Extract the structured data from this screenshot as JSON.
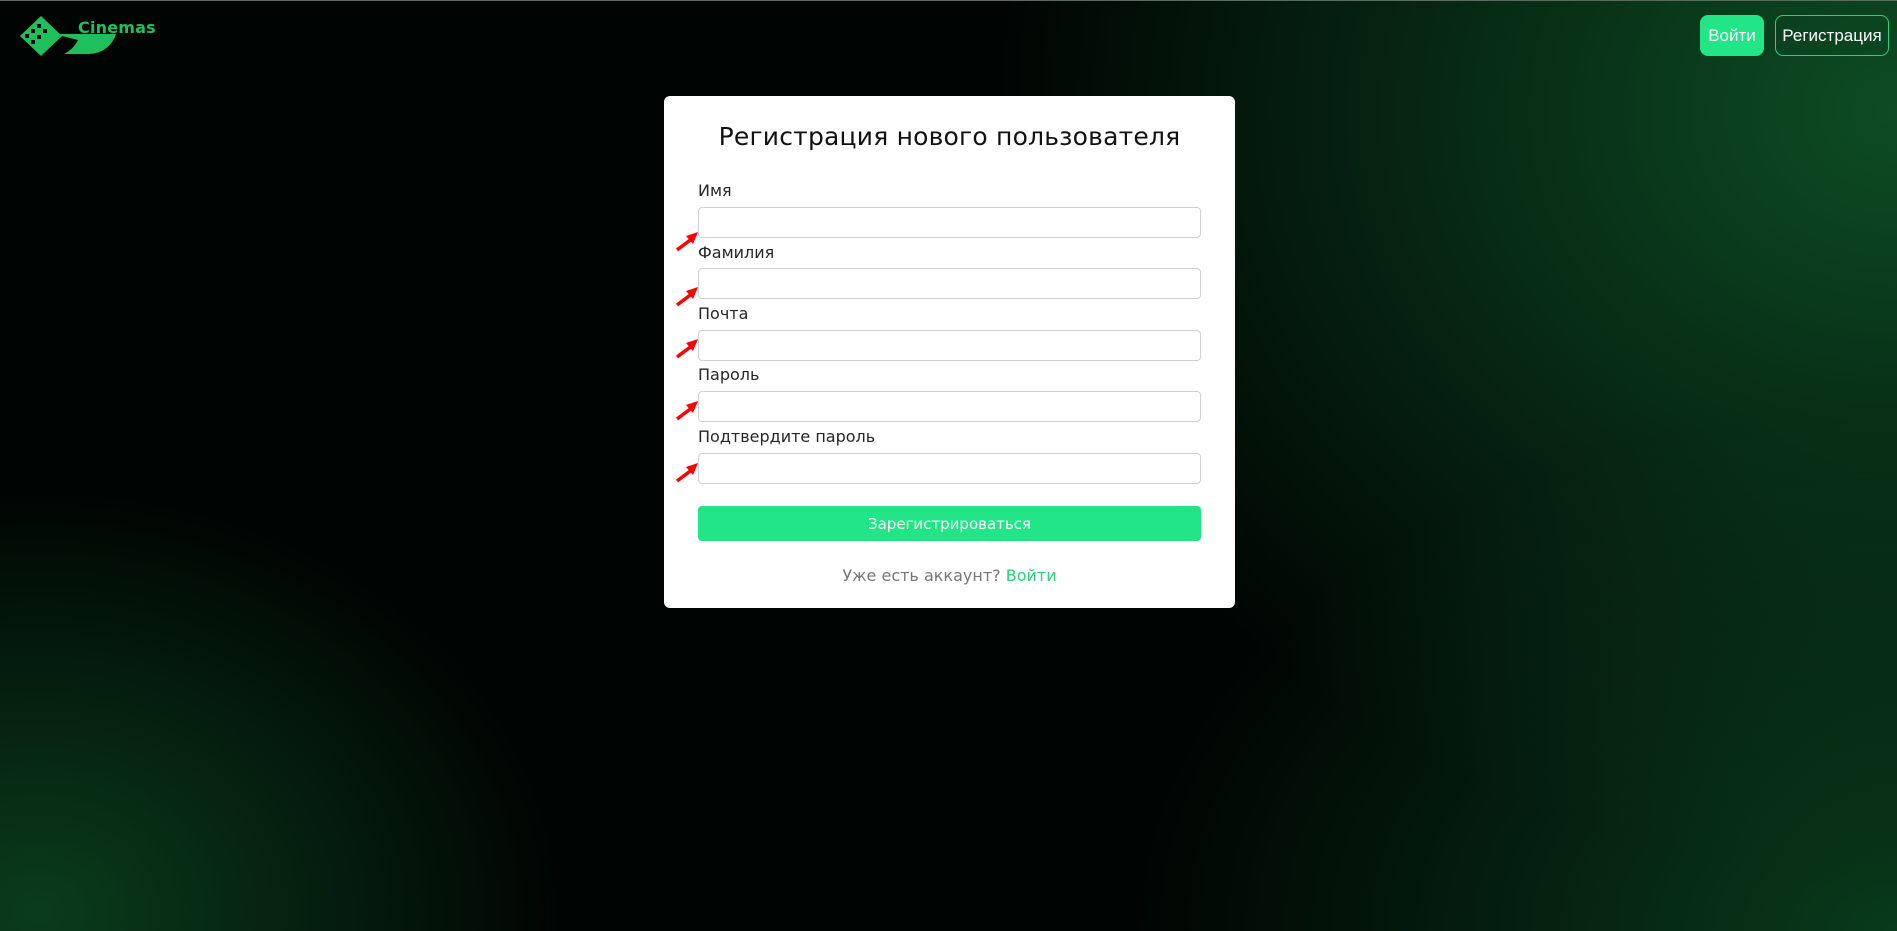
{
  "header": {
    "logo_text": "Cinemas",
    "login_label": "Войти",
    "register_label": "Регистрация"
  },
  "form": {
    "title": "Регистрация нового пользователя",
    "fields": [
      {
        "label": "Имя",
        "value": ""
      },
      {
        "label": "Фамилия",
        "value": ""
      },
      {
        "label": "Почта",
        "value": ""
      },
      {
        "label": "Пароль",
        "value": ""
      },
      {
        "label": "Подтвердите пароль",
        "value": ""
      }
    ],
    "submit_label": "Зарегистрироваться",
    "footer_text": "Уже есть аккаунт?",
    "footer_link": "Войти"
  },
  "colors": {
    "accent": "#22e587",
    "link": "#2fd07a",
    "annotation_arrow": "#ff0000"
  }
}
